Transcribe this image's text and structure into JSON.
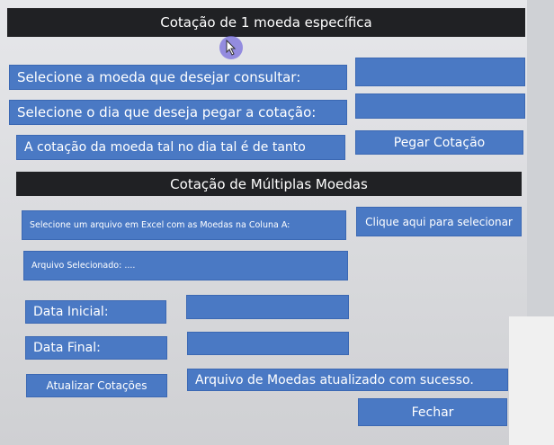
{
  "single": {
    "header": "Cotação de 1 moeda específica",
    "select_currency_label": "Selecione a moeda que desejar consultar:",
    "select_day_label": "Selecione o dia que deseja pegar a cotação:",
    "result_text": "A cotação da moeda tal no dia tal é de tanto",
    "get_button": "Pegar Cotação"
  },
  "multi": {
    "header": "Cotação de Múltiplas Moedas",
    "select_file_label": "Selecione um arquivo em Excel com as Moedas na Coluna A:",
    "select_button": "Clique aqui para selecionar",
    "selected_file_label": "Arquivo Selecionado: ....",
    "start_date_label": "Data Inicial:",
    "end_date_label": "Data Final:",
    "update_button": "Atualizar Cotações",
    "status_text": "Arquivo de Moedas atualizado com sucesso.",
    "close_button": "Fechar"
  },
  "colors": {
    "accent": "#4a79c4",
    "header_bg": "#202124"
  }
}
